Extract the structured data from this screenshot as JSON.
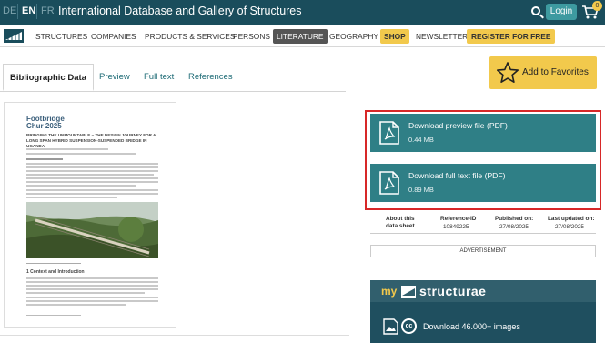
{
  "topbar": {
    "languages": [
      "DE",
      "EN",
      "FR"
    ],
    "active_language": "EN",
    "site_title": "International Database and Gallery of Structures",
    "login_label": "Login",
    "cart_count": "0"
  },
  "nav": {
    "items": [
      "STRUCTURES",
      "COMPANIES",
      "PRODUCTS & SERVICES",
      "PERSONS",
      "LITERATURE",
      "GEOGRAPHY",
      "SHOP",
      "NEWSLETTER",
      "REGISTER FOR FREE"
    ],
    "active": "LITERATURE"
  },
  "tabs": [
    "Bibliographic Data",
    "Preview",
    "Full text",
    "References"
  ],
  "favorites_label": "Add to Favorites",
  "paper": {
    "header_line1": "Footbridge",
    "header_line2": "Chur 2025",
    "title": "BRIDGING THE UNMOUNTABLE – THE DESIGN JOURNEY FOR A LONG SPAN HYBRID SUSPENSION-SUSPENDED BRIDGE IN UGANDA",
    "section_heading": "1   Context and Introduction"
  },
  "downloads": [
    {
      "label": "Download preview file (PDF)",
      "size": "0.44 MB"
    },
    {
      "label": "Download full text file (PDF)",
      "size": "0.89 MB"
    }
  ],
  "metadata": {
    "about_line1": "About this",
    "about_line2": "data sheet",
    "reference_label": "Reference-ID",
    "reference_value": "10849225",
    "published_label": "Published on:",
    "published_value": "27/08/2025",
    "updated_label": "Last updated on:",
    "updated_value": "27/08/2025"
  },
  "advertisement": "ADVERTISEMENT",
  "promo": {
    "my": "my",
    "brand": "structurae",
    "download_label": "Download 46.000+ images"
  },
  "colors": {
    "topbar": "#1a4d5c",
    "accent_teal": "#2f7f86",
    "highlight_yellow": "#f2c94c",
    "frame_red": "#d72828"
  }
}
